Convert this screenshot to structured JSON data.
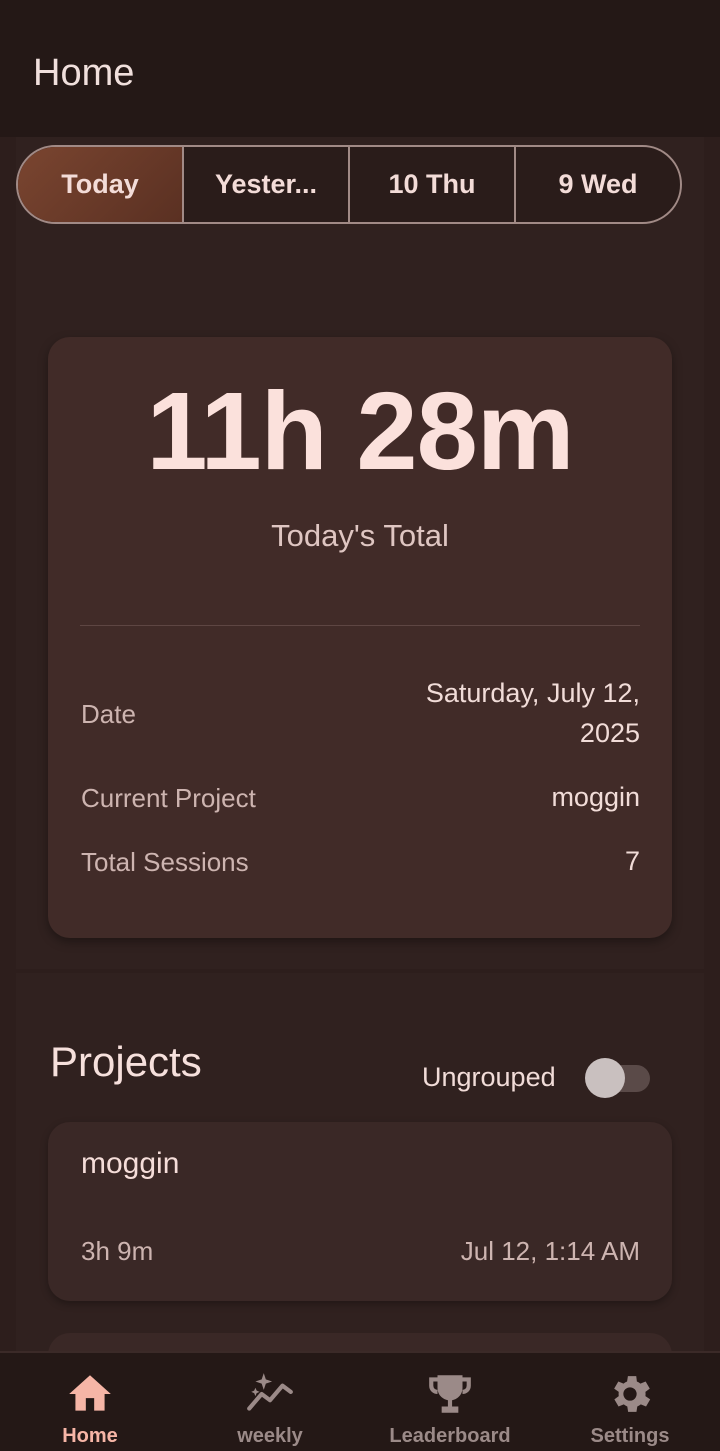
{
  "app_bar": {
    "title": "Home"
  },
  "day_selector": {
    "options": [
      "Today",
      "Yester...",
      "10 Thu",
      "9 Wed"
    ],
    "selected": "Today"
  },
  "summary": {
    "total_time": "11h 28m",
    "total_label": "Today's Total",
    "rows": [
      {
        "label": "Date",
        "value_line1": "Saturday, July 12,",
        "value_line2": "2025"
      },
      {
        "label": "Current Project",
        "value": "moggin"
      },
      {
        "label": "Total Sessions",
        "value": "7"
      }
    ]
  },
  "projects": {
    "title": "Projects",
    "toggle_label": "Ungrouped",
    "toggle_on": false,
    "items": [
      {
        "name": "moggin",
        "duration": "3h 9m",
        "last_active": "Jul 12, 1:14 AM"
      }
    ]
  },
  "bottom_nav": {
    "items": [
      {
        "label": "Home",
        "icon": "home-icon",
        "active": true
      },
      {
        "label": "weekly",
        "icon": "trending-sparkle-icon",
        "active": false
      },
      {
        "label": "Leaderboard",
        "icon": "trophy-icon",
        "active": false
      },
      {
        "label": "Settings",
        "icon": "gear-icon",
        "active": false
      }
    ]
  },
  "colors": {
    "background": "#2d1e1c",
    "accent": "#f6b5a6",
    "selected_segment": "#7a4530"
  }
}
